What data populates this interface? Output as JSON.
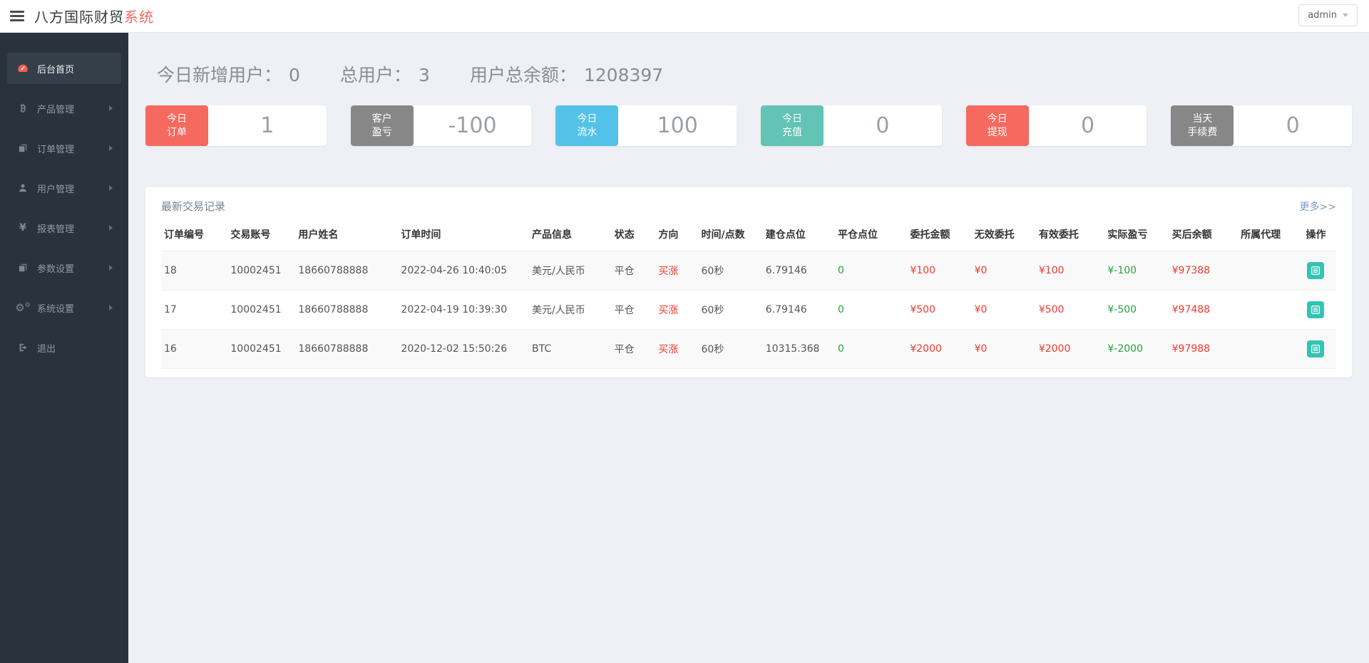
{
  "topbar": {
    "title_main": "八方国际财贸",
    "title_accent": "系统",
    "user_dropdown": {
      "label": "admin"
    }
  },
  "sidebar": {
    "items": [
      {
        "id": "home",
        "label": "后台首页",
        "icon": "dashboard-icon",
        "active": true,
        "has_submenu": false
      },
      {
        "id": "products",
        "label": "产品管理",
        "icon": "bitcoin-icon",
        "active": false,
        "has_submenu": true
      },
      {
        "id": "orders",
        "label": "订单管理",
        "icon": "order-files-icon",
        "active": false,
        "has_submenu": true
      },
      {
        "id": "users",
        "label": "用户管理",
        "icon": "user-icon",
        "active": false,
        "has_submenu": true
      },
      {
        "id": "reports",
        "label": "报表管理",
        "icon": "yen-icon",
        "active": false,
        "has_submenu": true
      },
      {
        "id": "params",
        "label": "参数设置",
        "icon": "param-files-icon",
        "active": false,
        "has_submenu": true
      },
      {
        "id": "system",
        "label": "系统设置",
        "icon": "gears-icon",
        "active": false,
        "has_submenu": true
      },
      {
        "id": "logout",
        "label": "退出",
        "icon": "logout-icon",
        "active": false,
        "has_submenu": false
      }
    ]
  },
  "summary": [
    {
      "label": "今日新增用户：",
      "value": "0"
    },
    {
      "label": "总用户：",
      "value": "3"
    },
    {
      "label": "用户总余额：",
      "value": "1208397"
    }
  ],
  "stat_cards": [
    {
      "label": [
        "今日",
        "订单"
      ],
      "value": "1",
      "color": "#f5695f"
    },
    {
      "label": [
        "客户",
        "盈亏"
      ],
      "value": "-100",
      "color": "#878787"
    },
    {
      "label": [
        "今日",
        "流水"
      ],
      "value": "100",
      "color": "#54c2e8"
    },
    {
      "label": [
        "今日",
        "充值"
      ],
      "value": "0",
      "color": "#63c3b4"
    },
    {
      "label": [
        "今日",
        "提现"
      ],
      "value": "0",
      "color": "#f5695f"
    },
    {
      "label": [
        "当天",
        "手续费"
      ],
      "value": "0",
      "color": "#878787"
    }
  ],
  "table_card": {
    "title": "最新交易记录",
    "more_link": "更多>>",
    "columns": [
      "订单编号",
      "交易账号",
      "用户姓名",
      "订单时间",
      "产品信息",
      "状态",
      "方向",
      "时间/点数",
      "建仓点位",
      "平仓点位",
      "委托金额",
      "无效委托",
      "有效委托",
      "实际盈亏",
      "买后余额",
      "所属代理",
      "操作"
    ],
    "action_icon": "detail-list-icon",
    "rows": [
      {
        "order_id": "18",
        "account": "10002451",
        "username": "18660788888",
        "order_time": "2022-04-26 10:40:05",
        "product": "美元/人民币",
        "status": "平仓",
        "direction": "买涨",
        "duration": "60秒",
        "open_point": "6.79146",
        "close_point": "0",
        "entrust_amount": "¥100",
        "invalid_entrust": "¥0",
        "valid_entrust": "¥100",
        "actual_profit": "¥-100",
        "balance_after": "¥97388",
        "agent": ""
      },
      {
        "order_id": "17",
        "account": "10002451",
        "username": "18660788888",
        "order_time": "2022-04-19 10:39:30",
        "product": "美元/人民币",
        "status": "平仓",
        "direction": "买涨",
        "duration": "60秒",
        "open_point": "6.79146",
        "close_point": "0",
        "entrust_amount": "¥500",
        "invalid_entrust": "¥0",
        "valid_entrust": "¥500",
        "actual_profit": "¥-500",
        "balance_after": "¥97488",
        "agent": ""
      },
      {
        "order_id": "16",
        "account": "10002451",
        "username": "18660788888",
        "order_time": "2020-12-02 15:50:26",
        "product": "BTC",
        "status": "平仓",
        "direction": "买涨",
        "duration": "60秒",
        "open_point": "10315.368",
        "close_point": "0",
        "entrust_amount": "¥2000",
        "invalid_entrust": "¥0",
        "valid_entrust": "¥2000",
        "actual_profit": "¥-2000",
        "balance_after": "¥97988",
        "agent": ""
      }
    ]
  },
  "colors": {
    "accent_red": "#f5695f",
    "card_gray": "#878787",
    "card_blue": "#54c2e8",
    "card_teal": "#63c3b4",
    "text_red": "#ee3b30",
    "text_green": "#23a53c",
    "action_button_teal": "#35c3b3",
    "link_blue": "#7b9dc1",
    "sidebar_bg": "#2a333d"
  }
}
